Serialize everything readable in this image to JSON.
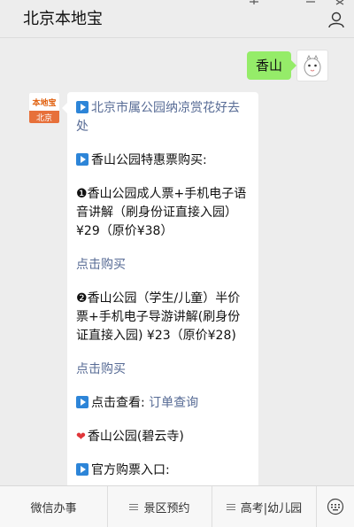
{
  "header": {
    "title": "北京本地宝",
    "icons": [
      "add-icon",
      "minimize-icon",
      "close-icon",
      "person-icon"
    ]
  },
  "user_message": {
    "text": "香山"
  },
  "bot_avatar": {
    "top_text": "本地宝",
    "bottom_text": "北京"
  },
  "bot_message": {
    "line1": "北京市属公园纳凉赏花好去处",
    "line2": "香山公园特惠票购买:",
    "item1_num": "❶",
    "item1_text": "香山公园成人票+手机电子语音讲解（刷身份证直接入园）¥29（原价¥38）",
    "link1": "点击购买",
    "item2_num": "❷",
    "item2_text": "香山公园（学生/儿童）半价票+手机电子导游讲解(刷身份证直接入园) ¥23（原价¥28)",
    "link2": "点击购买",
    "view_label": "点击查看:",
    "view_link": "订单查询",
    "heart_text": "香山公园(碧云寺)",
    "official_text": "官方购票入口:"
  },
  "bottom_menu": {
    "tab1": "微信办事",
    "tab2": "景区预约",
    "tab3": "高考|幼儿园",
    "keyboard_icon": "keyboard-icon"
  }
}
